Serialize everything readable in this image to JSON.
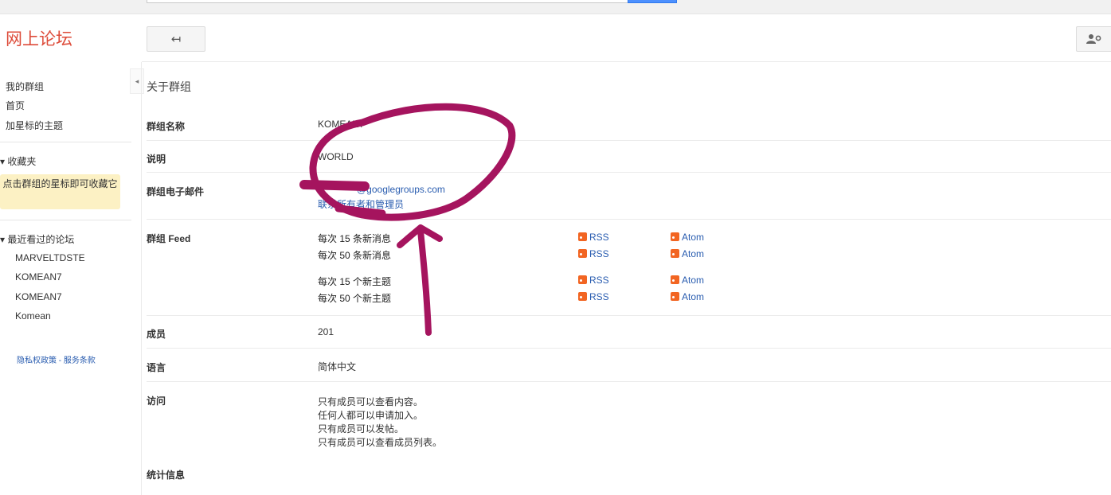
{
  "header": {
    "logo": "网上论坛",
    "back_glyph": "↤"
  },
  "sidebar": {
    "nav": [
      "我的群组",
      "首页",
      "加星标的主题"
    ],
    "collapse_glyph": "◂",
    "favorites_heading": "▾ 收藏夹",
    "favorites_hint": "点击群组的星标即可收藏它",
    "recent_heading": "▾ 最近看过的论坛",
    "recent_items": [
      "MARVELTDSTE",
      "KOMEAN7",
      "KOMEAN7",
      "Komean"
    ],
    "footer": "隐私权政策 - 服务条款"
  },
  "main": {
    "section_title": "关于群组",
    "rows": {
      "name_label": "群组名称",
      "name_value": "KOMEAN7",
      "desc_label": "说明",
      "desc_value": "WORLD",
      "email_label": "群组电子邮件",
      "email_value": "@googlegroups.com",
      "email_contact": "联系所有者和管理员",
      "feed_label": "群组 Feed",
      "feeds": [
        {
          "text": "每次 15 条新消息",
          "rss": "RSS",
          "atom": "Atom"
        },
        {
          "text": "每次 50 条新消息",
          "rss": "RSS",
          "atom": "Atom"
        },
        {
          "text": "每次 15 个新主题",
          "rss": "RSS",
          "atom": "Atom"
        },
        {
          "text": "每次 50 个新主题",
          "rss": "RSS",
          "atom": "Atom"
        }
      ],
      "members_label": "成员",
      "members_value": "201",
      "lang_label": "语言",
      "lang_value": "简体中文",
      "access_label": "访问",
      "access_lines": [
        "只有成员可以查看内容。",
        "任何人都可以申请加入。",
        "只有成员可以发帖。",
        "只有成员可以查看成员列表。"
      ],
      "stats_label": "统计信息"
    }
  },
  "colors": {
    "logo": "#dd4b39",
    "link": "#2a5db0",
    "feed_icon": "#f26522",
    "annotation": "#a5145e",
    "star_hint_bg": "#fcf1c4"
  }
}
